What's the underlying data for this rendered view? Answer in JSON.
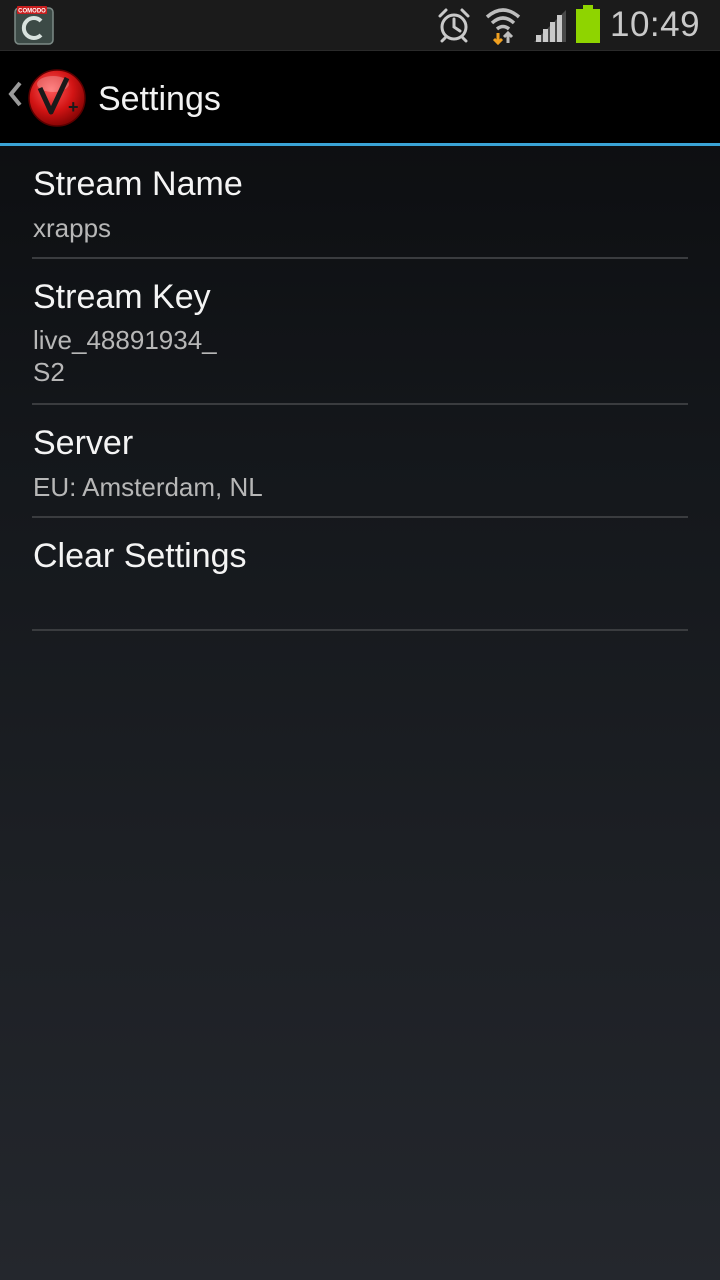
{
  "status_bar": {
    "notification_app": "COMODO",
    "time": "10:49",
    "icons": [
      "comodo-icon",
      "alarm-icon",
      "wifi-icon",
      "signal-icon",
      "battery-icon"
    ],
    "battery_color": "#8fd400"
  },
  "action_bar": {
    "title": "Settings",
    "app_icon_text": "V+",
    "accent_color": "#3aa3d6"
  },
  "preferences": [
    {
      "title": "Stream Name",
      "summary": "xrapps"
    },
    {
      "title": "Stream Key",
      "summary": "live_48891934_\nS2"
    },
    {
      "title": "Server",
      "summary": "EU: Amsterdam, NL"
    },
    {
      "title": "Clear Settings",
      "summary": ""
    }
  ]
}
